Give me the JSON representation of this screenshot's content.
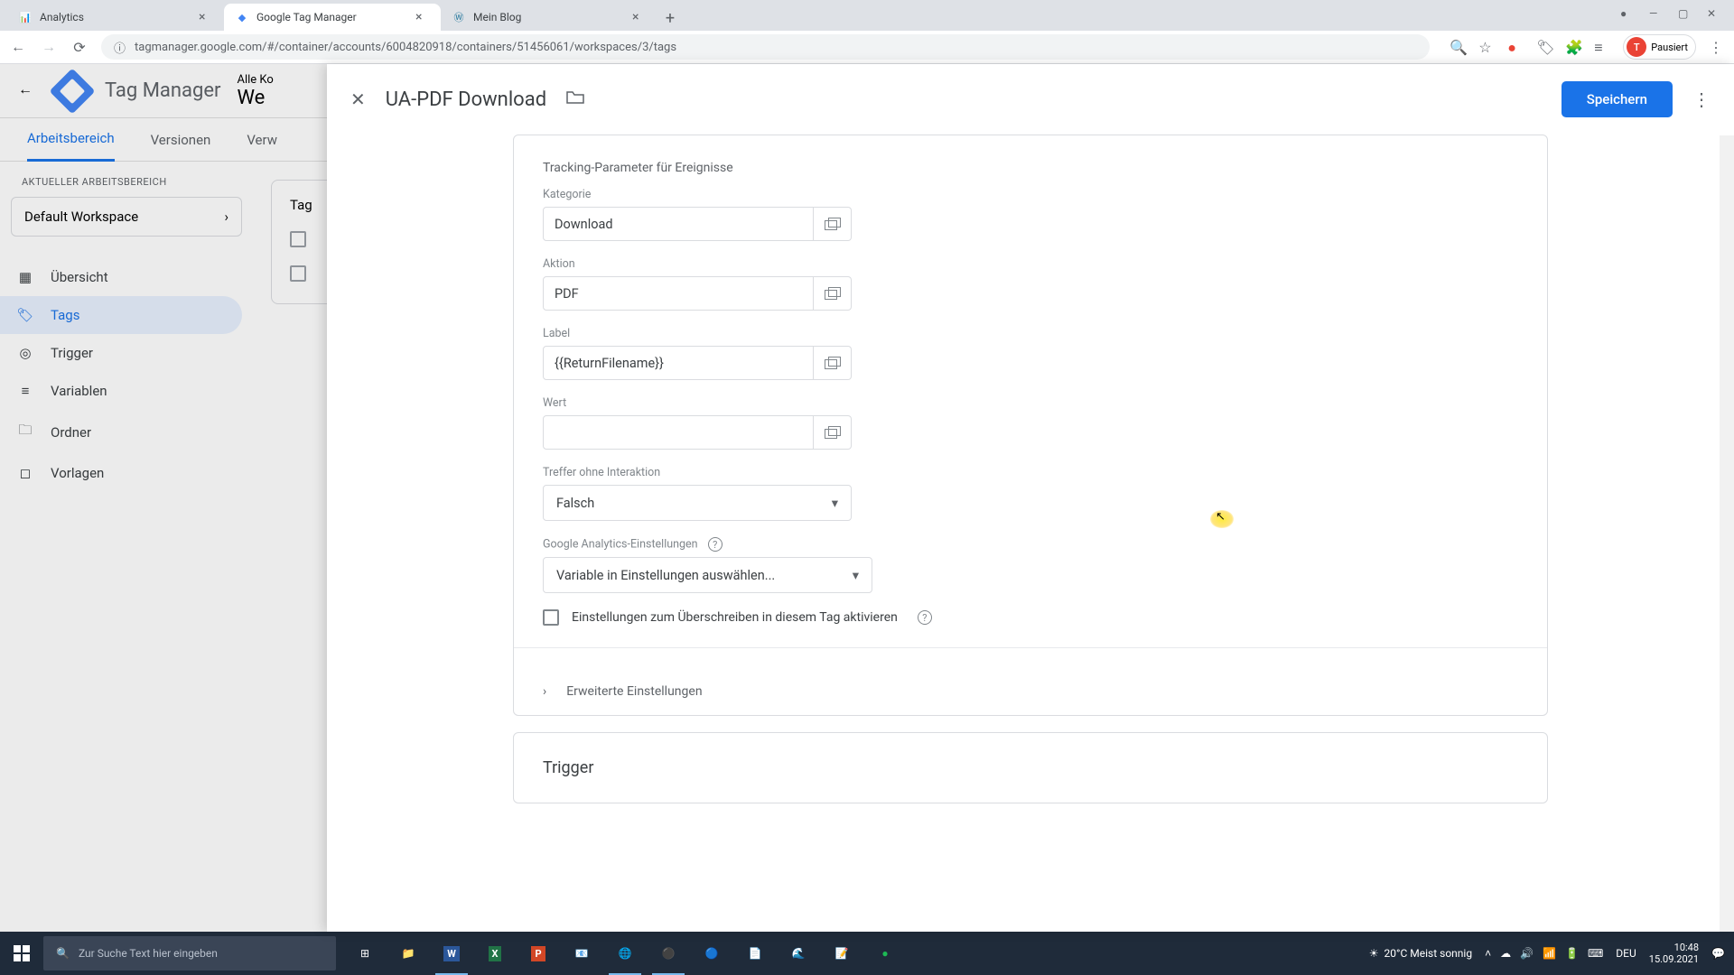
{
  "browser": {
    "tabs": [
      {
        "title": "Analytics",
        "favicon": "📊"
      },
      {
        "title": "Google Tag Manager",
        "favicon": "◆"
      },
      {
        "title": "Mein Blog",
        "favicon": "Ⓦ"
      }
    ],
    "url": "tagmanager.google.com/#/container/accounts/6004820918/containers/51456061/workspaces/3/tags",
    "paused_label": "Pausiert"
  },
  "gtm": {
    "app_title": "Tag Manager",
    "account_label": "Alle Ko",
    "workspace_big": "We",
    "tabs": [
      "Arbeitsbereich",
      "Versionen",
      "Verw"
    ],
    "ws_section_label": "AKTUELLER ARBEITSBEREICH",
    "workspace_name": "Default Workspace",
    "nav": [
      {
        "icon": "▦",
        "label": "Übersicht"
      },
      {
        "icon": "🏷",
        "label": "Tags"
      },
      {
        "icon": "◎",
        "label": "Trigger"
      },
      {
        "icon": "≡",
        "label": "Variablen"
      },
      {
        "icon": "🗀",
        "label": "Ordner"
      },
      {
        "icon": "◻",
        "label": "Vorlagen"
      }
    ],
    "table_header": "Tag"
  },
  "overlay": {
    "title": "UA-PDF Download",
    "save_label": "Speichern",
    "section_title": "Tracking-Parameter für Ereignisse",
    "fields": {
      "kategorie": {
        "label": "Kategorie",
        "value": "Download"
      },
      "aktion": {
        "label": "Aktion",
        "value": "PDF"
      },
      "label": {
        "label": "Label",
        "value": "{{ReturnFilename}}"
      },
      "wert": {
        "label": "Wert",
        "value": ""
      },
      "treffer": {
        "label": "Treffer ohne Interaktion",
        "value": "Falsch"
      },
      "ga_settings": {
        "label": "Google Analytics-Einstellungen",
        "value": "Variable in Einstellungen auswählen..."
      }
    },
    "override_label": "Einstellungen zum Überschreiben in diesem Tag aktivieren",
    "advanced_label": "Erweiterte Einstellungen",
    "trigger_title": "Trigger"
  },
  "taskbar": {
    "search_placeholder": "Zur Suche Text hier eingeben",
    "weather": "20°C  Meist sonnig",
    "lang": "DEU",
    "time": "10:48",
    "date": "15.09.2021"
  }
}
